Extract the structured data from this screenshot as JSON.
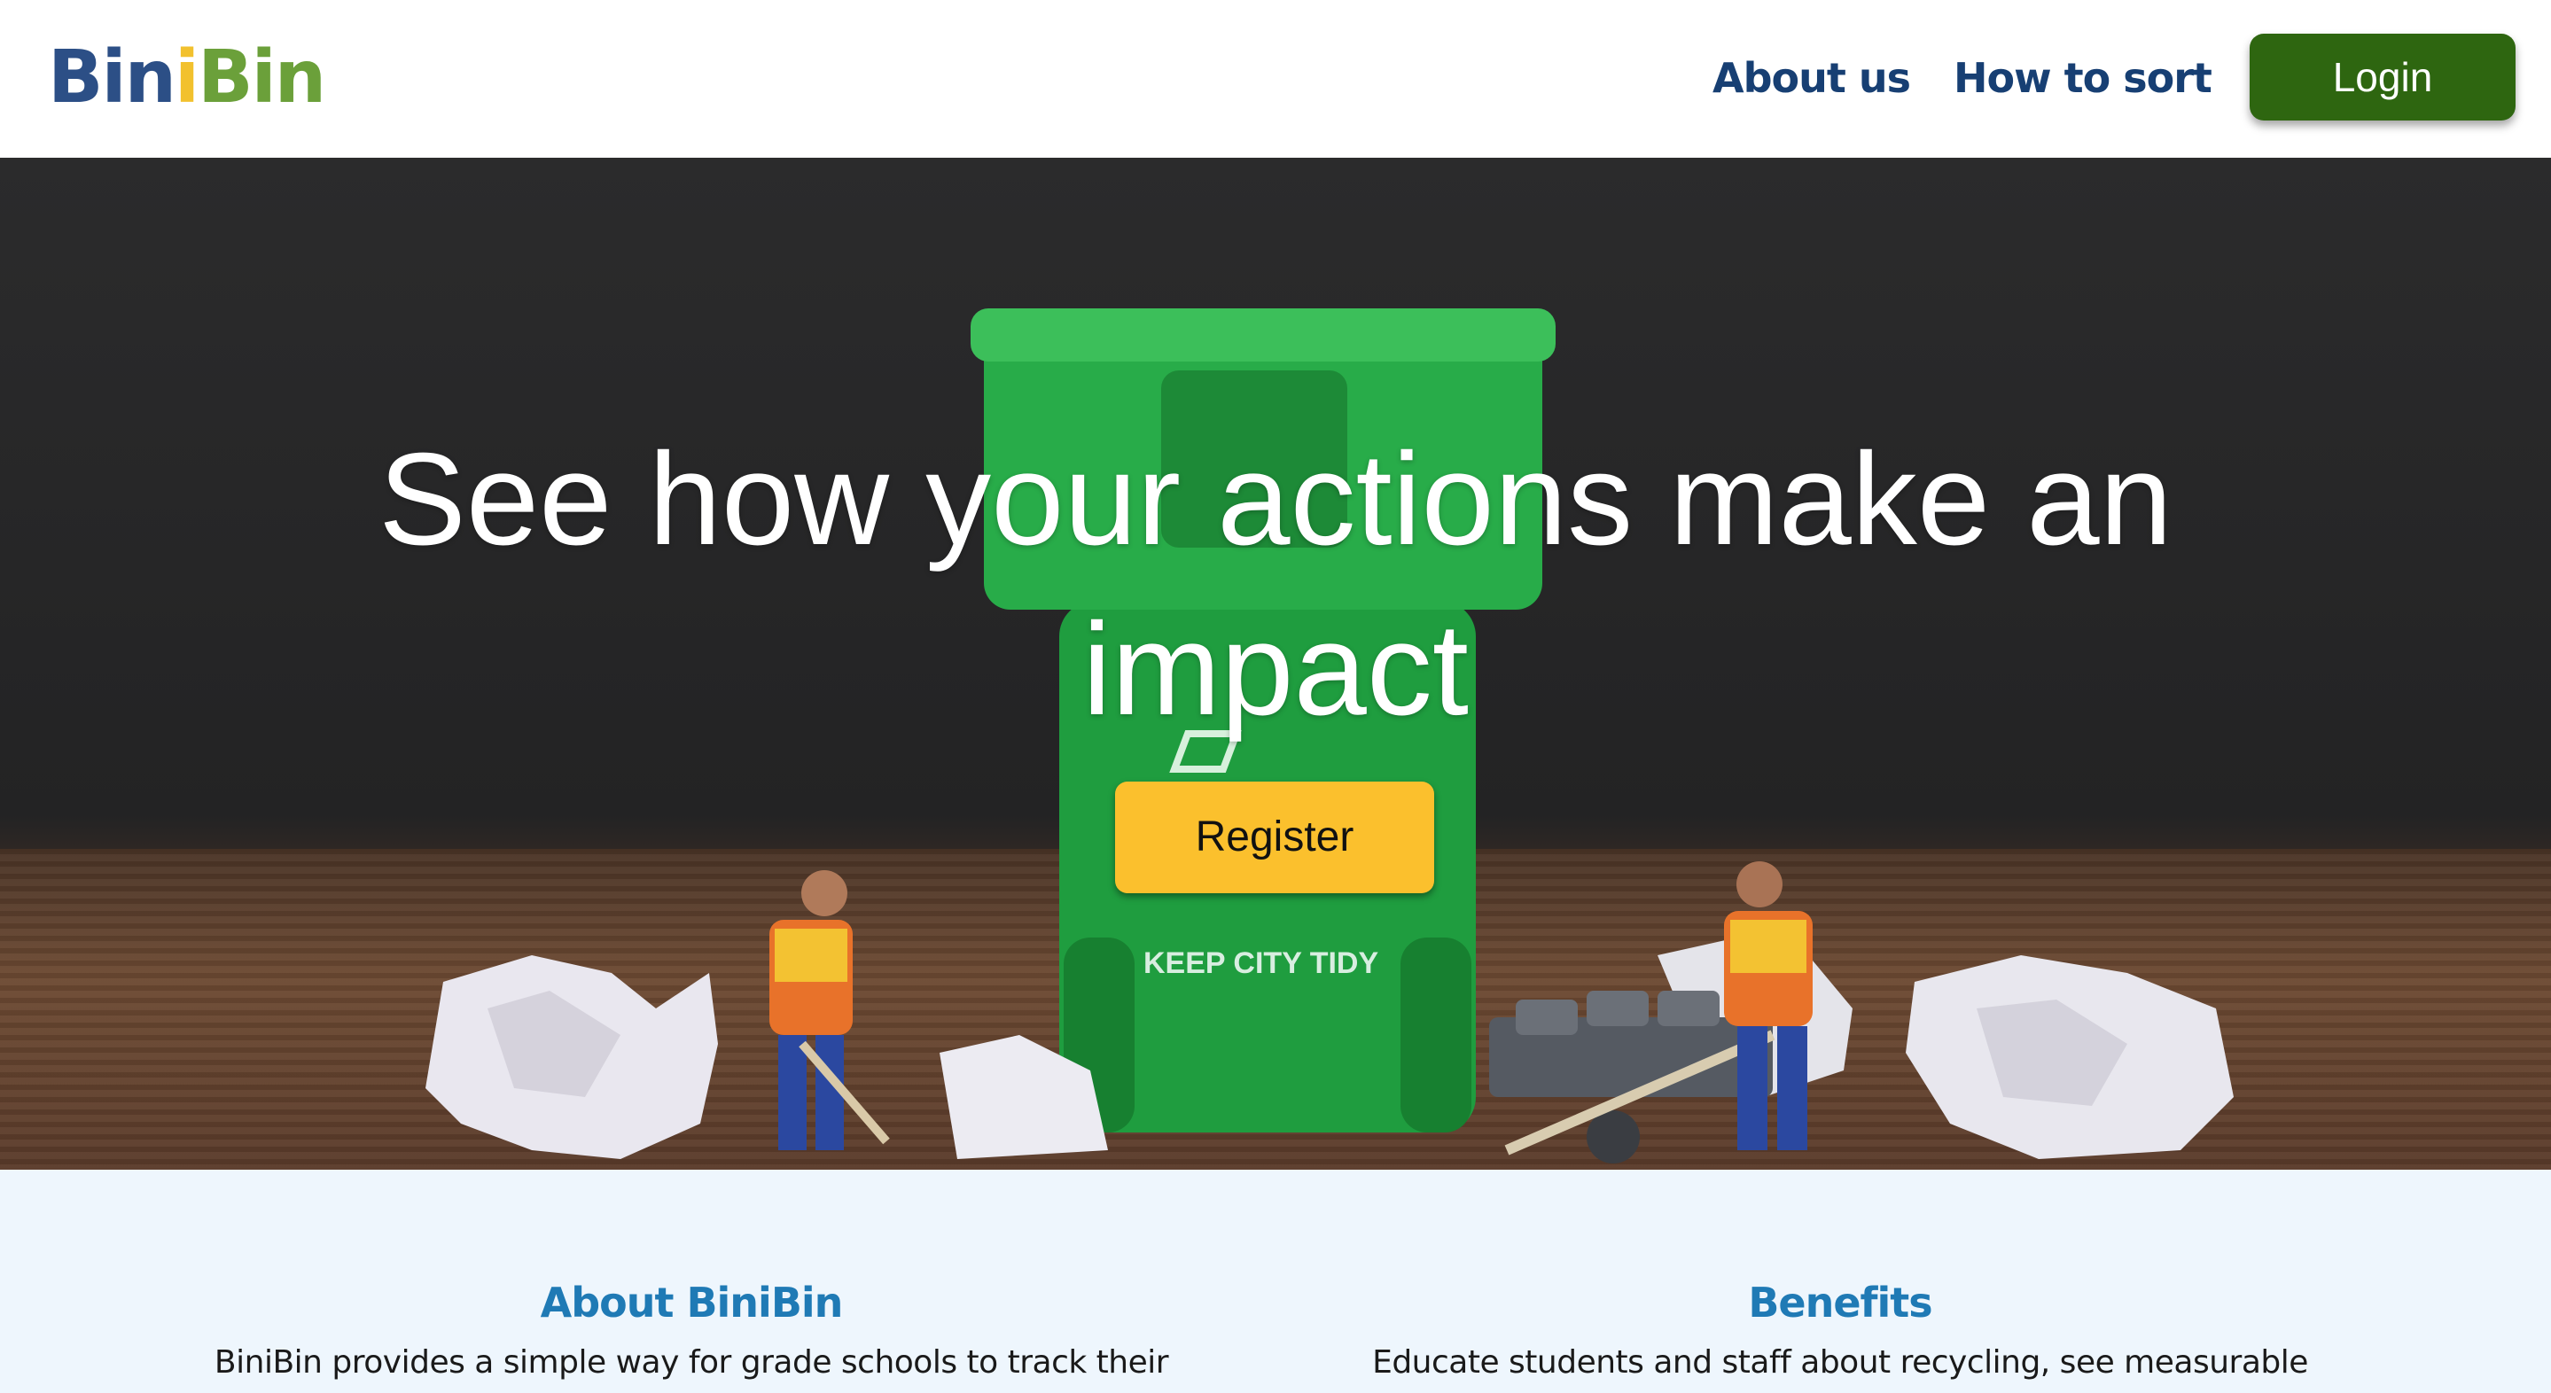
{
  "header": {
    "logo": {
      "part1": "Bin",
      "dot": "i",
      "part2": "Bin"
    },
    "nav": {
      "about": "About us",
      "sort": "How to sort"
    },
    "login_label": "Login"
  },
  "hero": {
    "title": "See how your actions make an impact",
    "register_label": "Register",
    "bin_text": "KEEP CITY TIDY"
  },
  "info": {
    "about": {
      "heading": "About BiniBin",
      "text": "BiniBin provides a simple way for grade schools to track their"
    },
    "benefits": {
      "heading": "Benefits",
      "text": "Educate students and staff about recycling, see measurable"
    }
  },
  "colors": {
    "brand_blue": "#2c4f86",
    "brand_yellow": "#f2c12e",
    "brand_green": "#6ba03a",
    "login_green": "#2e6610",
    "register_yellow": "#fbc02d",
    "nav_text": "#173f73",
    "info_heading": "#1f7ab5",
    "info_bg": "#eef6fd"
  }
}
